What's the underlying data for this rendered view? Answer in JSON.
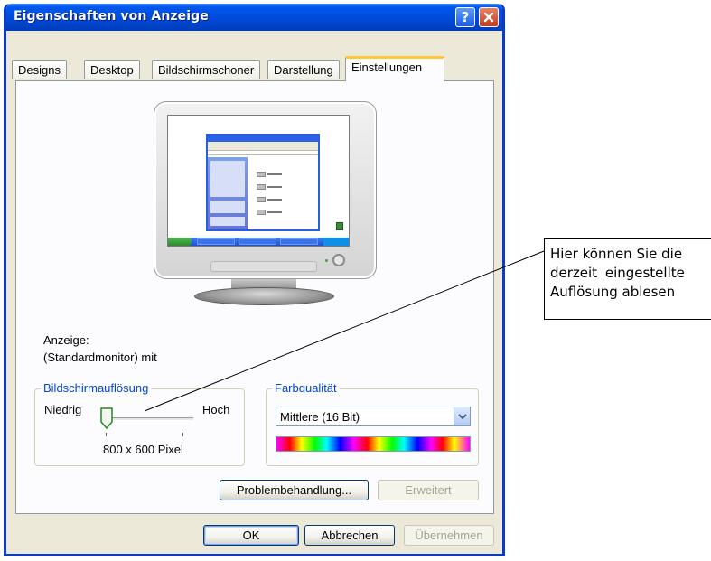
{
  "window": {
    "title": "Eigenschaften von Anzeige",
    "help_glyph": "?"
  },
  "tabs": [
    {
      "label": "Designs",
      "active": false
    },
    {
      "label": "Desktop",
      "active": false
    },
    {
      "label": "Bildschirmschoner",
      "active": false
    },
    {
      "label": "Darstellung",
      "active": false
    },
    {
      "label": "Einstellungen",
      "active": true
    }
  ],
  "display": {
    "label": "Anzeige:",
    "monitor": "(Standardmonitor) mit"
  },
  "resolution_group": {
    "legend": "Bildschirmauflösung",
    "low_label": "Niedrig",
    "high_label": "Hoch",
    "value": "800 x 600 Pixel",
    "slider_position": 0
  },
  "color_group": {
    "legend": "Farbqualität",
    "selected": "Mittlere (16 Bit)"
  },
  "buttons": {
    "troubleshoot": "Problembehandlung...",
    "advanced": "Erweitert",
    "ok": "OK",
    "cancel": "Abbrechen",
    "apply": "Übernehmen"
  },
  "callout": {
    "line1": "Hier können Sie die",
    "line2": "derzeit  eingestellte",
    "line3": "Auflösung ablesen"
  },
  "colors": {
    "titlebar": "#0050e0",
    "group_legend": "#0046d5",
    "active_tab_highlight": "#ffc83c"
  }
}
